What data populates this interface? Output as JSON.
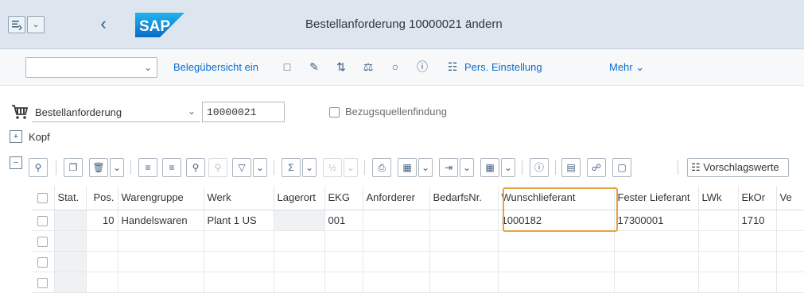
{
  "window": {
    "title": "Bestellanforderung 10000021 ändern",
    "logo_text": "SAP"
  },
  "toolbar": {
    "select_value": "",
    "doc_overview": "Belegübersicht ein",
    "pers_settings": "Pers. Einstellung",
    "more": "Mehr"
  },
  "header": {
    "doc_type": "Bestellanforderung",
    "doc_number": "10000021",
    "source_determination": "Bezugsquellenfindung",
    "kopf": "Kopf"
  },
  "items_toolbar": {
    "default_values": "Vorschlagswerte"
  },
  "table": {
    "columns": [
      "Stat.",
      "Pos.",
      "Warengruppe",
      "Werk",
      "Lagerort",
      "EKG",
      "Anforderer",
      "BedarfsNr.",
      "Wunschlieferant",
      "Fester Lieferant",
      "LWk",
      "EkOr",
      "Ve"
    ],
    "rows": [
      {
        "stat": "",
        "pos": "10",
        "warengruppe": "Handelswaren",
        "werk": "Plant 1 US",
        "lagerort": "",
        "ekg": "001",
        "anforderer": "",
        "bedarfsnr": "",
        "wunschlieferant": "1000182",
        "fester_lieferant": "17300001",
        "lwk": "",
        "ekor": "1710",
        "ve": ""
      }
    ]
  },
  "colors": {
    "titlebar": "#dde6ee",
    "highlight": "#e8a33d",
    "link": "#0a6ed1"
  }
}
